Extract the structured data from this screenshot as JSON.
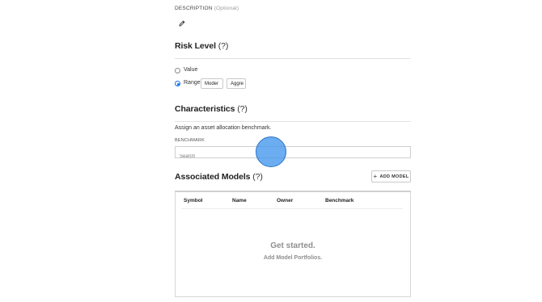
{
  "description": {
    "label": "DESCRIPTION",
    "optional": "(Optional)",
    "edit_icon": "pencil-icon"
  },
  "risk_level": {
    "title": "Risk Level",
    "help": "(?)",
    "options": [
      {
        "label": "Value",
        "checked": false
      },
      {
        "label": "Range",
        "checked": true
      }
    ],
    "range_inputs": [
      "Moder",
      "Aggre"
    ]
  },
  "characteristics": {
    "title": "Characteristics",
    "help": "(?)",
    "description": "Assign an asset allocation benchmark.",
    "benchmark_label": "BENCHMARK",
    "search_placeholder": "Search"
  },
  "associated_models": {
    "title": "Associated Models",
    "help": "(?)",
    "add_button": {
      "icon": "+",
      "label": "ADD MODEL"
    },
    "columns": [
      "Symbol",
      "Name",
      "Owner",
      "Benchmark"
    ],
    "empty_title": "Get started.",
    "empty_subtitle": "Add Model Portfolios."
  },
  "colors": {
    "accent": "#1a73e8",
    "touch_indicator": "#4296ee"
  }
}
